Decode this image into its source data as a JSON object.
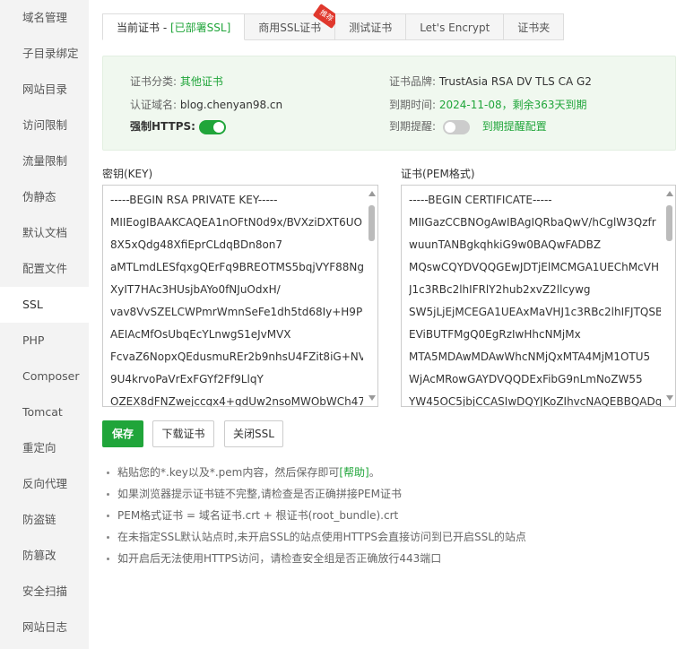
{
  "sidebar": {
    "items": [
      {
        "label": "域名管理"
      },
      {
        "label": "子目录绑定"
      },
      {
        "label": "网站目录"
      },
      {
        "label": "访问限制"
      },
      {
        "label": "流量限制"
      },
      {
        "label": "伪静态"
      },
      {
        "label": "默认文档"
      },
      {
        "label": "配置文件"
      },
      {
        "label": "SSL"
      },
      {
        "label": "PHP"
      },
      {
        "label": "Composer"
      },
      {
        "label": "Tomcat"
      },
      {
        "label": "重定向"
      },
      {
        "label": "反向代理"
      },
      {
        "label": "防盗链"
      },
      {
        "label": "防篡改"
      },
      {
        "label": "安全扫描"
      },
      {
        "label": "网站日志"
      }
    ],
    "active": "SSL"
  },
  "tabs": [
    {
      "label": "当前证书 - ",
      "extra": "[已部署SSL]"
    },
    {
      "label": "商用SSL证书",
      "badge": "推荐"
    },
    {
      "label": "测试证书"
    },
    {
      "label": "Let's Encrypt"
    },
    {
      "label": "证书夹"
    }
  ],
  "cert_info": {
    "category_label": "证书分类:",
    "category_value": "其他证书",
    "domain_label": "认证域名:",
    "domain_value": "blog.chenyan98.cn",
    "https_label": "强制HTTPS:",
    "brand_label": "证书品牌:",
    "brand_value": "TrustAsia RSA DV TLS CA G2",
    "expire_label": "到期时间:",
    "expire_value": "2024-11-08，剩余363天到期",
    "remind_label": "到期提醒:",
    "remind_link": "到期提醒配置"
  },
  "toggles": {
    "force_https": true,
    "expire_remind": false
  },
  "key": {
    "label": "密钥(KEY)",
    "lines": [
      "-----BEGIN RSA PRIVATE KEY-----",
      "MIIEogIBAAKCAQEA1nOFtN0d9x/BVXziDXT6UO",
      "8X5xQdg48XfiEprCLdqBDn8on7",
      "aMTLmdLESfqxgQErFq9BREOTMS5bqjVYF88Ng",
      "XyIT7HAc3HUsjbAYo0fNJuOdxH/",
      "vav8VvSZELCWPmrWmnSeFe1dh5td68Iy+H9P0",
      "AEIAcMfOsUbqEcYLnwgS1eJvMVX",
      "FcvaZ6NopxQEdusmuREr2b9nhsU4FZit8iG+NVF",
      "9U4krvoPaVrExFGYf2Ff9LlqY",
      "OZEX8dFNZwejccgx4+gdUw2nsoMWObWCh47I"
    ]
  },
  "cert": {
    "label": "证书(PEM格式)",
    "lines": [
      "-----BEGIN CERTIFICATE-----",
      "MIIGazCCBNOgAwIBAgIQRbaQwV/hCglW3Qzfr",
      "wuunTANBgkqhkiG9w0BAQwFADBZ",
      "MQswCQYDVQQGEwJDTjElMCMGA1UEChMcVH",
      "J1c3RBc2lhIFRlY2hub2xvZ2llcywg",
      "SW5jLjEjMCEGA1UEAxMaVHJ1c3RBc2lhIFJTQSB",
      "EViBUTFMgQ0EgRzIwHhcNMjMx",
      "MTA5MDAwMDAwWhcNMjQxMTA4MjM1OTU5",
      "WjAcMRowGAYDVQQDExFibG9nLmNoZW55",
      "YW45OC5jbjCCASIwDQYJKoZIhvcNAQEBBQADg"
    ]
  },
  "buttons": {
    "save": "保存",
    "download": "下载证书",
    "close_ssl": "关闭SSL"
  },
  "tips": [
    {
      "text": "粘贴您的*.key以及*.pem内容，然后保存即可",
      "link": "[帮助]",
      "after": "。"
    },
    {
      "text": "如果浏览器提示证书链不完整,请检查是否正确拼接PEM证书"
    },
    {
      "text": "PEM格式证书 = 域名证书.crt + 根证书(root_bundle).crt"
    },
    {
      "text": "在未指定SSL默认站点时,未开启SSL的站点使用HTTPS会直接访问到已开启SSL的站点"
    },
    {
      "text": "如开启后无法使用HTTPS访问，请检查安全组是否正确放行443端口"
    }
  ],
  "colors": {
    "accent": "#20a53a",
    "info_bg": "#f0f8ef",
    "badge": "#e0382d"
  }
}
